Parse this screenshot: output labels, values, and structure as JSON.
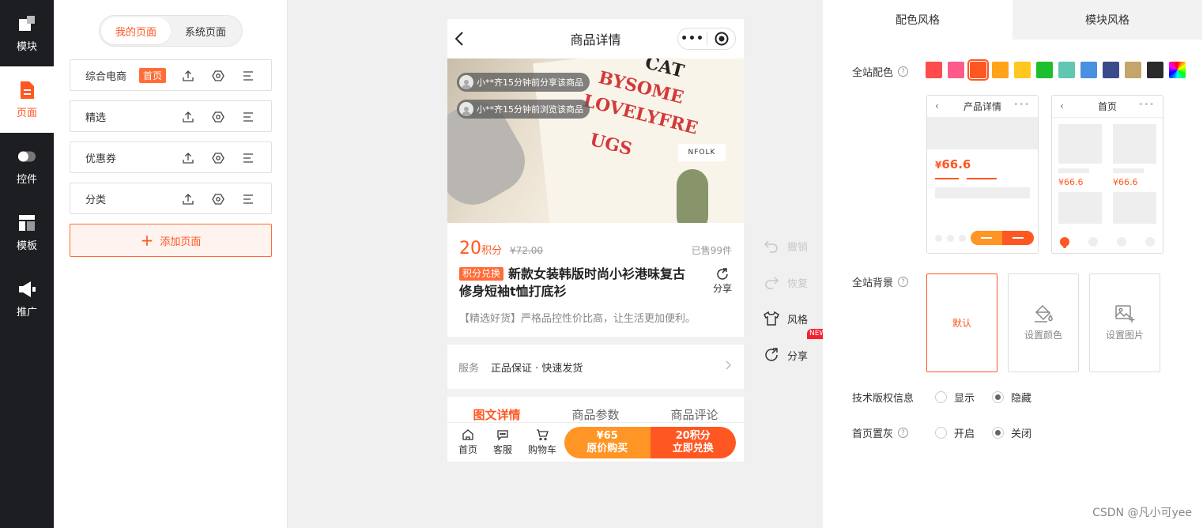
{
  "nav": {
    "items": [
      {
        "label": "模块",
        "icon": "blocks-icon"
      },
      {
        "label": "页面",
        "icon": "page-icon"
      },
      {
        "label": "控件",
        "icon": "toggle-icon"
      },
      {
        "label": "模板",
        "icon": "template-icon"
      },
      {
        "label": "推广",
        "icon": "megaphone-icon"
      }
    ],
    "active_index": 1
  },
  "pages": {
    "tabs": [
      "我的页面",
      "系统页面"
    ],
    "active_tab": 0,
    "list": [
      {
        "name": "综合电商",
        "tag": "首页"
      },
      {
        "name": "精选",
        "tag": ""
      },
      {
        "name": "优惠券",
        "tag": ""
      },
      {
        "name": "分类",
        "tag": ""
      }
    ],
    "add_label": "添加页面"
  },
  "phone": {
    "title": "商品详情",
    "capsule_dots": "•••",
    "hero_texts": [
      "CAT",
      "BYSOME",
      "LOVELYFRE",
      "UGS"
    ],
    "hero_label": "NFOLK",
    "bubbles": [
      "小**齐15分钟前分享该商品",
      "小**齐15分钟前浏览该商品"
    ],
    "price": "20",
    "price_unit": "积分",
    "original_price": "¥72.00",
    "sold": "已售99件",
    "badge": "积分兑换",
    "product_title": "新款女装韩版时尚小衫港味复古修身短袖t恤打底衫",
    "share_label": "分享",
    "description": "【精选好货】严格品控性价比高，让生活更加便利。",
    "service_key": "服务",
    "service_value": "正品保证 · 快速发货",
    "detail_tabs": [
      "图文详情",
      "商品参数",
      "商品评论"
    ],
    "active_detail_tab": 0,
    "bottom_icons": [
      {
        "label": "首页",
        "icon": "home-icon"
      },
      {
        "label": "客服",
        "icon": "chat-icon"
      },
      {
        "label": "购物车",
        "icon": "cart-icon"
      }
    ],
    "buy_original_price": "¥65",
    "buy_original_label": "原价购买",
    "buy_points_price": "20积分",
    "buy_points_label": "立即兑换"
  },
  "tools": [
    {
      "label": "撤销",
      "icon": "undo-icon",
      "enabled": false
    },
    {
      "label": "恢复",
      "icon": "redo-icon",
      "enabled": false
    },
    {
      "label": "风格",
      "icon": "shirt-icon",
      "enabled": true
    },
    {
      "label": "分享",
      "icon": "share-icon",
      "enabled": true,
      "badge": "NEW"
    }
  ],
  "right": {
    "tabs": [
      "配色风格",
      "模块风格"
    ],
    "active_tab": 0,
    "color_label": "全站配色",
    "swatches": [
      "#ff4b4b",
      "#ff5b8a",
      "#ff5722",
      "#ffa31a",
      "#ffc71f",
      "#1ebf2f",
      "#62c7b0",
      "#4a90e2",
      "#3a4a8a",
      "#c4a66b",
      "#2b2b2b",
      "rainbow"
    ],
    "selected_swatch": 2,
    "preview_detail": {
      "title": "产品详情",
      "price_symbol": "¥",
      "price": "66.6"
    },
    "preview_home": {
      "title": "首页",
      "price1": "¥66.6",
      "price2": "¥66.6"
    },
    "bg_label": "全站背景",
    "bg_options": [
      "默认",
      "设置颜色",
      "设置图片"
    ],
    "bg_selected": 0,
    "copyright_label": "技术版权信息",
    "copyright_options": [
      "显示",
      "隐藏"
    ],
    "copyright_selected": 1,
    "gray_label": "首页置灰",
    "gray_options": [
      "开启",
      "关闭"
    ],
    "gray_selected": 1
  },
  "watermark": "CSDN @凡小可yee",
  "accent": "#ff5722"
}
